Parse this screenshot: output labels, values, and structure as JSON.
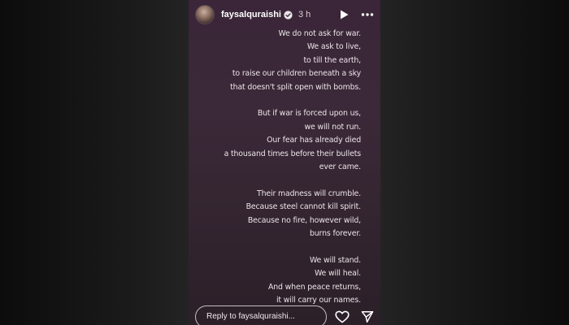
{
  "story": {
    "username": "faysalquraishi",
    "time": "3 h",
    "icons": {
      "avatar": "avatar",
      "verified": "verified-badge-icon",
      "play": "play-icon",
      "more": "more-options-icon",
      "heart": "heart-icon",
      "send": "send-icon"
    },
    "poem": [
      "We do not ask for war.",
      "We ask to live,",
      "to till the earth,",
      "to raise our children beneath a sky",
      "that doesn't split open with bombs.",
      "",
      "But if war is forced upon us,",
      "we will not run.",
      "Our fear has already died",
      "a thousand times before their bullets",
      "ever came.",
      "",
      "Their madness will crumble.",
      "Because steel cannot kill spirit.",
      "Because no fire, however wild,",
      "burns forever.",
      "",
      "We will stand.",
      "We will heal.",
      "And when peace returns,",
      "it will carry our names."
    ],
    "reply_placeholder": "Reply to faysalquraishi..."
  }
}
